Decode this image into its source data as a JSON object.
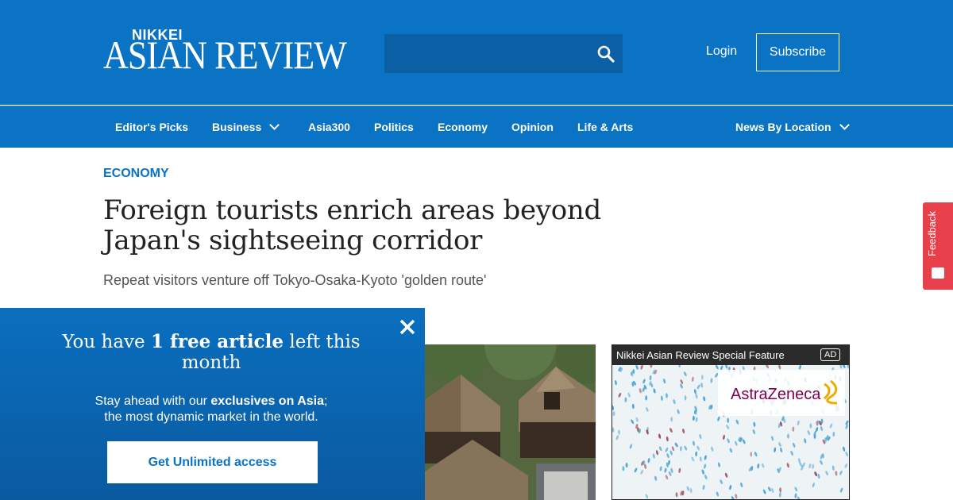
{
  "header": {
    "logo_top": "NIKKEI",
    "logo_main": "ASIAN REVIEW",
    "search_placeholder": "",
    "login_label": "Login",
    "subscribe_label": "Subscribe",
    "brand_color": "#0a73c4"
  },
  "nav": {
    "items": [
      {
        "label": "Editor's Picks"
      },
      {
        "label": "Business"
      },
      {
        "label": "Asia300"
      },
      {
        "label": "Politics"
      },
      {
        "label": "Economy"
      },
      {
        "label": "Opinion"
      },
      {
        "label": "Life & Arts"
      },
      {
        "label": "News By Location"
      }
    ]
  },
  "article": {
    "section": "ECONOMY",
    "headline": "Foreign tourists enrich areas beyond Japan's sightseeing corridor",
    "subhead": "Repeat visitors venture off Tokyo-Osaka-Kyoto 'golden route'"
  },
  "ad": {
    "title": "Nikkei Asian Review Special Feature",
    "tag": "AD",
    "brand": "AstraZeneca"
  },
  "feedback": {
    "label": "Feedback",
    "color": "#e8404a"
  },
  "paywall": {
    "title_pre": "You have ",
    "title_bold": "1 free article",
    "title_post": " left this month",
    "body_pre": "Stay ahead with our ",
    "body_bold": "exclusives on Asia",
    "body_post": ";",
    "body_line2": "the most dynamic market in the world.",
    "cta_label": "Get Unlimited access"
  },
  "icons": {
    "search": "search-icon",
    "close": "close-icon",
    "chevron": "chevron-down-icon"
  }
}
